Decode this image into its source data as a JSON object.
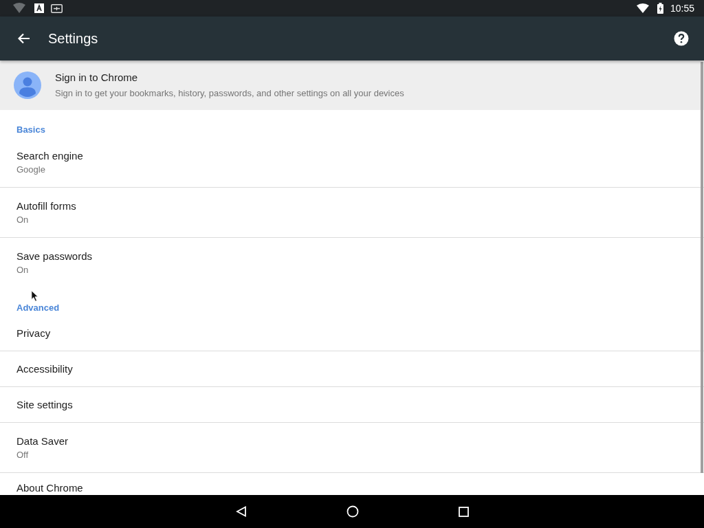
{
  "status_bar": {
    "time": "10:55"
  },
  "toolbar": {
    "title": "Settings"
  },
  "sign_in": {
    "title": "Sign in to Chrome",
    "summary": "Sign in to get your bookmarks, history, passwords, and other settings on all your devices"
  },
  "sections": [
    {
      "header": "Basics",
      "items": [
        {
          "title": "Search engine",
          "summary": "Google"
        },
        {
          "title": "Autofill forms",
          "summary": "On"
        },
        {
          "title": "Save passwords",
          "summary": "On"
        }
      ]
    },
    {
      "header": "Advanced",
      "items": [
        {
          "title": "Privacy"
        },
        {
          "title": "Accessibility"
        },
        {
          "title": "Site settings"
        },
        {
          "title": "Data Saver",
          "summary": "Off"
        },
        {
          "title": "About Chrome"
        }
      ]
    }
  ]
}
